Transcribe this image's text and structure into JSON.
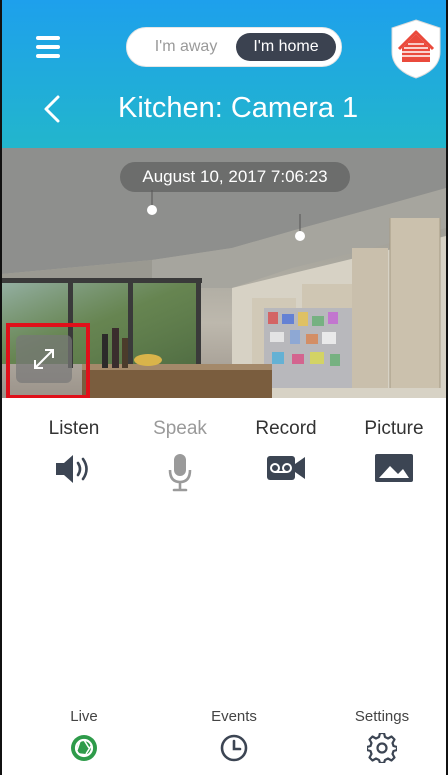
{
  "header": {
    "mode_away": "I'm away",
    "mode_home": "I'm home",
    "title": "Kitchen: Camera 1"
  },
  "video": {
    "timestamp": "August 10, 2017  7:06:23"
  },
  "controls": [
    {
      "label": "Listen",
      "icon": "speaker-icon",
      "enabled": true
    },
    {
      "label": "Speak",
      "icon": "microphone-icon",
      "enabled": false
    },
    {
      "label": "Record",
      "icon": "record-icon",
      "enabled": true
    },
    {
      "label": "Picture",
      "icon": "picture-icon",
      "enabled": true
    }
  ],
  "tabs": [
    {
      "label": "Live",
      "icon": "live-icon",
      "active": true
    },
    {
      "label": "Events",
      "icon": "clock-icon",
      "active": false
    },
    {
      "label": "Settings",
      "icon": "gear-icon",
      "active": false
    }
  ],
  "colors": {
    "header_gradient_top": "#1ea0ec",
    "header_gradient_bottom": "#22b6cc",
    "active_green": "#2e9b4a",
    "highlight_red": "#e0101a",
    "shield_roof": "#ea4a3c"
  }
}
